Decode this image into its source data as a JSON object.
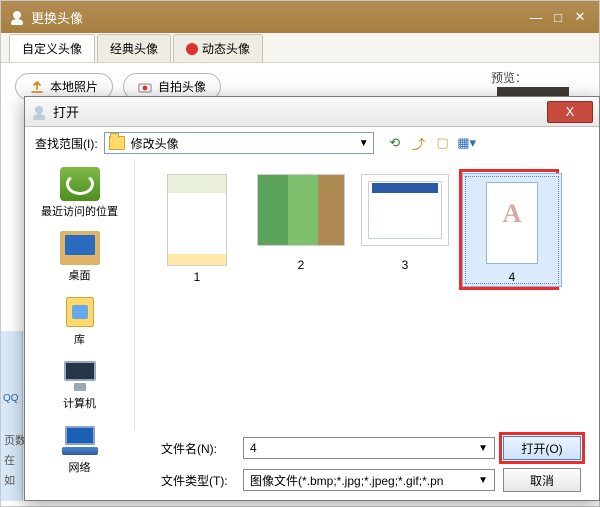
{
  "outer": {
    "title": "更换头像",
    "min": "—",
    "max": "□",
    "close": "✕",
    "tabs": {
      "custom": "自定义头像",
      "classic": "经典头像",
      "dynamic": "动态头像"
    },
    "btn_local": "本地照片",
    "btn_selfie": "自拍头像",
    "preview_label": "预览："
  },
  "left_fragments": {
    "qq": "QQ",
    "l1": "页数",
    "l2": "在",
    "l3": "如"
  },
  "dialog": {
    "title": "打开",
    "lookin_label": "查找范围(I):",
    "lookin_value": "修改头像",
    "places": {
      "recent": "最近访问的位置",
      "desktop": "桌面",
      "library": "库",
      "computer": "计算机",
      "network": "网络"
    },
    "files": [
      {
        "name": "1"
      },
      {
        "name": "2"
      },
      {
        "name": "3"
      },
      {
        "name": "4",
        "selected": true,
        "highlighted": true
      }
    ],
    "filename_label": "文件名(N):",
    "filename_value": "4",
    "filetype_label": "文件类型(T):",
    "filetype_value": "图像文件(*.bmp;*.jpg;*.jpeg;*.gif;*.pn",
    "open_btn": "打开(O)",
    "cancel_btn": "取消",
    "close_x": "X"
  }
}
